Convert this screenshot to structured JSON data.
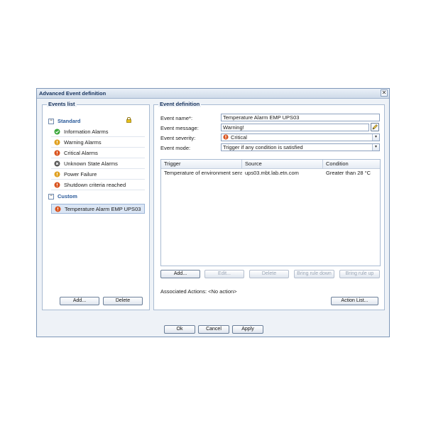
{
  "dialog": {
    "title": "Advanced Event definition",
    "close_glyph": "✕"
  },
  "events_list": {
    "legend": "Events list",
    "standard_label": "Standard",
    "toggle_glyph": "−",
    "standard_items": [
      {
        "label": "Information Alarms",
        "icon": "green-check-icon",
        "color": "#3aa63a"
      },
      {
        "label": "Warning Alarms",
        "icon": "warning-icon",
        "color": "#e0a020"
      },
      {
        "label": "Critical Alarms",
        "icon": "critical-icon",
        "color": "#d9531e"
      },
      {
        "label": "Unknown State Alarms",
        "icon": "unknown-icon",
        "color": "#555555"
      },
      {
        "label": "Power Failure",
        "icon": "warning-icon",
        "color": "#e0a020"
      },
      {
        "label": "Shutdown criteria reached",
        "icon": "critical-icon",
        "color": "#d9531e"
      }
    ],
    "custom_label": "Custom",
    "custom_items": [
      {
        "label": "Temperature Alarm EMP UPS03",
        "icon": "critical-icon",
        "color": "#d9531e"
      }
    ],
    "add_label": "Add...",
    "delete_label": "Delete"
  },
  "event_definition": {
    "legend": "Event definition",
    "name_label": "Event name*:",
    "name_value": "Temperature Alarm EMP UPS03",
    "message_label": "Event message:",
    "message_value": "Warning!",
    "severity_label": "Event severity:",
    "severity_value": "Critical",
    "mode_label": "Event mode:",
    "mode_value": "Trigger if any condition is satisfied",
    "dropdown_glyph": "▾",
    "table": {
      "columns": [
        "Trigger",
        "Source",
        "Condition"
      ],
      "rows": [
        [
          "Temperature of environment senso...",
          "ups03.mbt.lab.etn.com",
          "Greater than 28 °C"
        ]
      ]
    },
    "buttons": {
      "add": "Add...",
      "edit": "Edit...",
      "delete": "Delete",
      "down": "Bring rule down",
      "up": "Bring rule up"
    },
    "associated_actions": "Associated Actions: <No action>",
    "action_list": "Action List..."
  },
  "footer": {
    "ok": "Ok",
    "cancel": "Cancel",
    "apply": "Apply"
  }
}
